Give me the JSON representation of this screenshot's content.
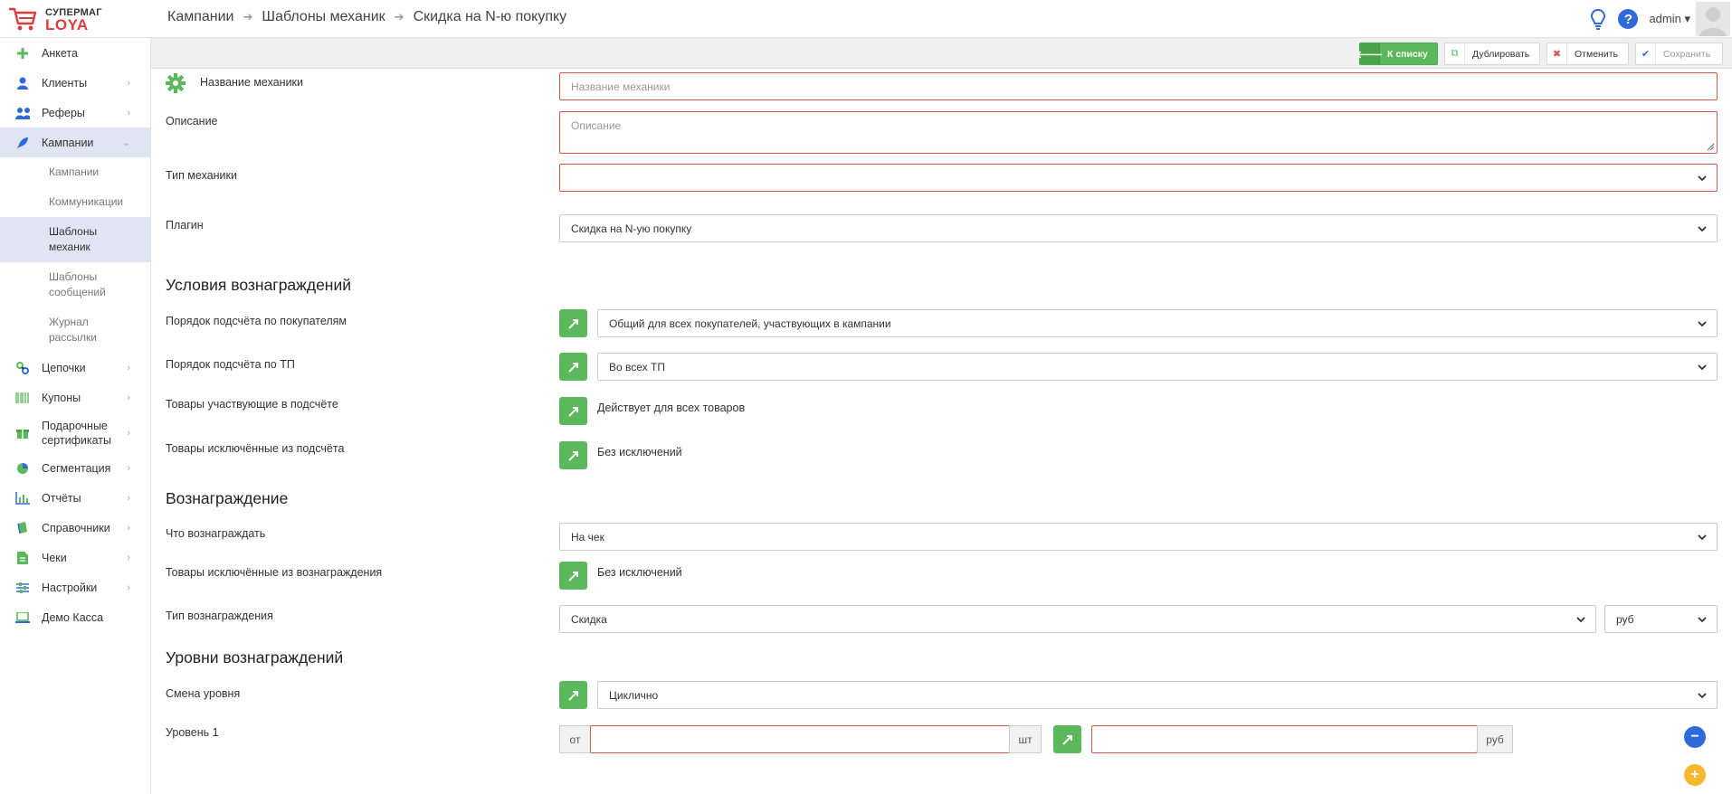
{
  "logo": {
    "top": "СУПЕРМАГ",
    "bottom": "LOYA"
  },
  "breadcrumb": [
    "Кампании",
    "Шаблоны механик",
    "Скидка на N-ю покупку"
  ],
  "user": {
    "name": "admin"
  },
  "sidebar": {
    "items": [
      {
        "label": "Анкета",
        "icon": "plus-icon"
      },
      {
        "label": "Клиенты",
        "icon": "user-icon"
      },
      {
        "label": "Реферы",
        "icon": "users-icon"
      },
      {
        "label": "Кампании",
        "icon": "rocket-icon"
      },
      {
        "label": "Цепочки",
        "icon": "chain-icon"
      },
      {
        "label": "Купоны",
        "icon": "barcode-icon"
      },
      {
        "label": "Подарочные сертификаты",
        "icon": "gift-icon"
      },
      {
        "label": "Сегментация",
        "icon": "pie-icon"
      },
      {
        "label": "Отчёты",
        "icon": "bar-chart-icon"
      },
      {
        "label": "Справочники",
        "icon": "book-icon"
      },
      {
        "label": "Чеки",
        "icon": "receipt-icon"
      },
      {
        "label": "Настройки",
        "icon": "sliders-icon"
      },
      {
        "label": "Демо Касса",
        "icon": "laptop-icon"
      }
    ],
    "sub_items": [
      "Кампании",
      "Коммуникации",
      "Шаблоны механик",
      "Шаблоны сообщений",
      "Журнал рассылки"
    ]
  },
  "actions": {
    "back": "К списку",
    "duplicate": "Дублировать",
    "cancel": "Отменить",
    "save": "Сохранить"
  },
  "form": {
    "name_label": "Название механики",
    "name_placeholder": "Название механики",
    "desc_label": "Описание",
    "desc_placeholder": "Описание",
    "type_label": "Тип механики",
    "type_value": "",
    "plugin_label": "Плагин",
    "plugin_value": "Скидка на N-ую покупку"
  },
  "conditions": {
    "title": "Условия вознаграждений",
    "buyers_label": "Порядок подсчёта по покупателям",
    "buyers_value": "Общий для всех покупателей, участвующих в кампании",
    "tp_label": "Порядок подсчёта по ТП",
    "tp_value": "Во всех ТП",
    "goods_label": "Товары участвующие в подсчёте",
    "goods_value": "Действует для всех товаров",
    "excluded_label": "Товары исключённые из подсчёта",
    "excluded_value": "Без исключений"
  },
  "reward": {
    "title": "Вознаграждение",
    "what_label": "Что вознаграждать",
    "what_value": "На чек",
    "excluded_label": "Товары исключённые из вознаграждения",
    "excluded_value": "Без исключений",
    "type_label": "Тип вознаграждения",
    "type_value": "Скидка",
    "currency_value": "руб"
  },
  "levels": {
    "title": "Уровни вознаграждений",
    "change_label": "Смена уровня",
    "change_value": "Циклично",
    "level1_label": "Уровень 1",
    "from_addon": "от",
    "qty_addon": "шт",
    "rub_addon": "руб",
    "remove_icon": "minus-icon",
    "add_icon": "plus-icon"
  },
  "colors": {
    "green": "#5cb85c",
    "error": "#d9534f",
    "active_nav": "#dfe5f3",
    "blue": "#2f6bd8",
    "yellow": "#f5b82e"
  }
}
